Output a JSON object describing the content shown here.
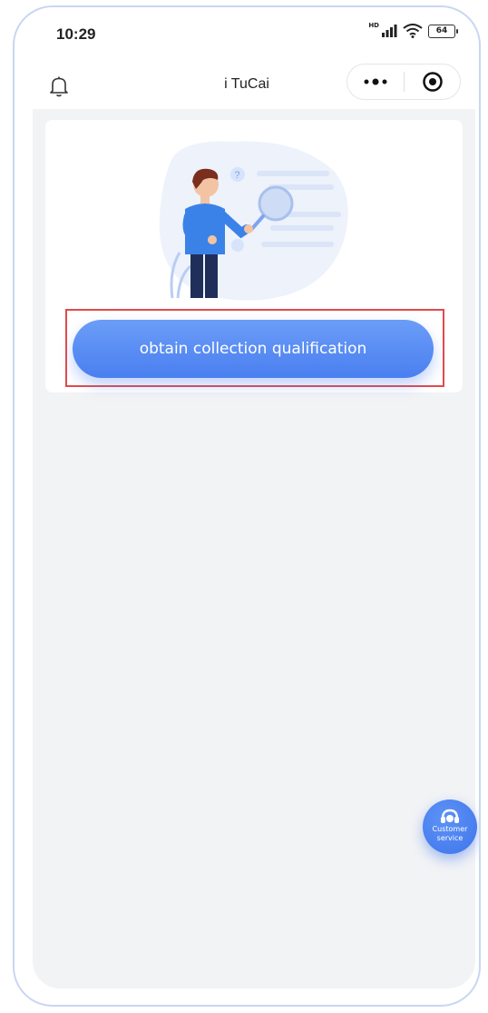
{
  "status_bar": {
    "time": "10:29",
    "network_badge": "HD",
    "battery_level": "64"
  },
  "nav": {
    "title": "i TuCai",
    "icons": {
      "left": "bell-icon",
      "more": "more-dots-icon",
      "close": "target-circle-icon"
    }
  },
  "card": {
    "illustration": "person-with-magnifier-illustration",
    "cta_label": "obtain collection qualification"
  },
  "floating": {
    "label_line1": "Customer",
    "label_line2": "service",
    "icon": "headset-icon"
  },
  "colors": {
    "primary": "#4a7ff0",
    "highlight": "#e34a4a",
    "background": "#f2f3f5"
  }
}
